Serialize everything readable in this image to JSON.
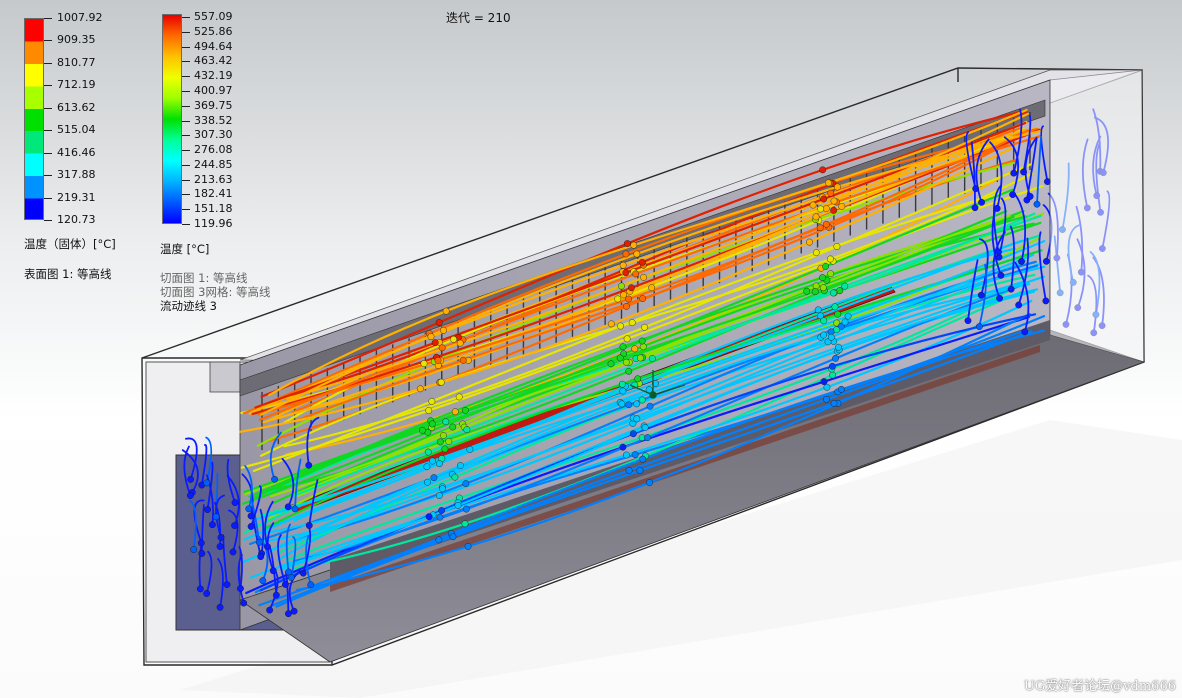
{
  "iteration_label": "迭代 = 210",
  "solid_legend": {
    "values": [
      "1007.92",
      "909.35",
      "810.77",
      "712.19",
      "613.62",
      "515.04",
      "416.46",
      "317.88",
      "219.31",
      "120.73"
    ],
    "colors": [
      "#ff0000",
      "#ff8a00",
      "#ffff00",
      "#a8ff00",
      "#00e000",
      "#00e87a",
      "#00ffff",
      "#0093ff",
      "#0000ff"
    ],
    "title": "温度（固体）[°C]",
    "plot": "表面图 1: 等高线"
  },
  "fluid_legend": {
    "values": [
      "557.09",
      "525.86",
      "494.64",
      "463.42",
      "432.19",
      "400.97",
      "369.75",
      "338.52",
      "307.30",
      "276.08",
      "244.85",
      "213.63",
      "182.41",
      "151.18",
      "119.96"
    ],
    "gradient": [
      "#e80000",
      "#ff6a00",
      "#ffc000",
      "#f0ff00",
      "#9dff00",
      "#00e000",
      "#00ff96",
      "#00ffff",
      "#00b4ff",
      "#005aff",
      "#0000ff"
    ],
    "title": "温度 [°C]",
    "plots": [
      "切面图 1: 等高线",
      "切面图 3网格: 等高线",
      "流动迹线 3"
    ]
  },
  "watermark": "UG爱好者论坛@vdm666"
}
